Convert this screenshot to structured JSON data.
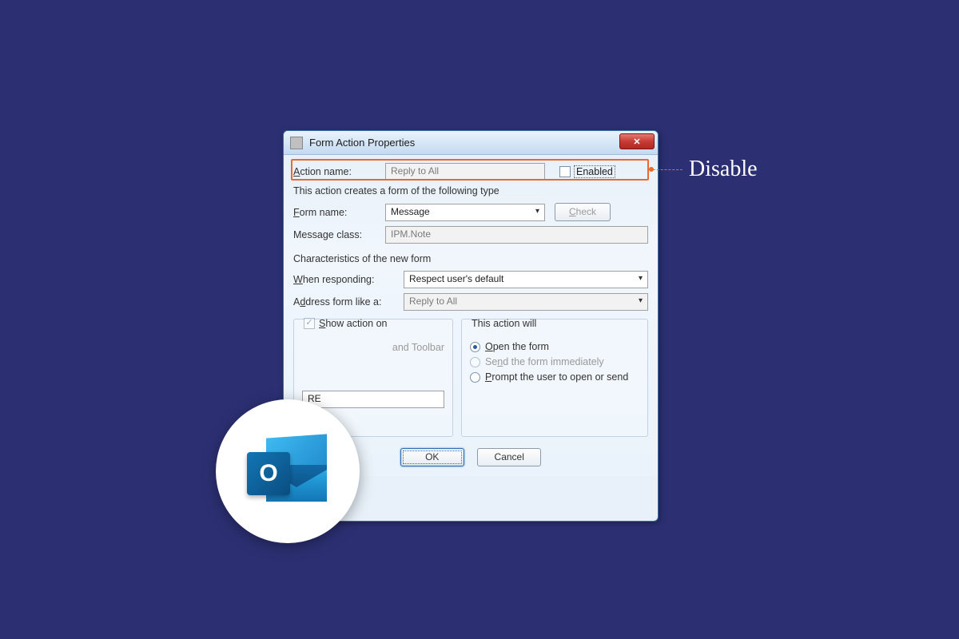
{
  "dialog": {
    "title": "Form Action Properties",
    "action_name_label": "Action name:",
    "action_name_value": "Reply to All",
    "enabled_label": "Enabled",
    "creates_text": "This action creates a form of the following type",
    "form_name_label": "Form name:",
    "form_name_value": "Message",
    "check_btn": "Check",
    "message_class_label": "Message class:",
    "message_class_value": "IPM.Note",
    "characteristics_text": "Characteristics of the new form",
    "when_responding_label": "When responding:",
    "when_responding_value": "Respect user's default",
    "address_like_label": "Address form like a:",
    "address_like_value": "Reply to All",
    "show_action_legend": "Show action on",
    "menu_toolbar": "and Toolbar",
    "this_action_legend": "This action will",
    "open_form": "Open the form",
    "send_immediately": "Send the form immediately",
    "prompt_user": "Prompt the user to open or send",
    "prefix_value": "RE",
    "ok": "OK",
    "cancel": "Cancel"
  },
  "callout": {
    "text": "Disable"
  },
  "outlook": {
    "letter": "O"
  }
}
